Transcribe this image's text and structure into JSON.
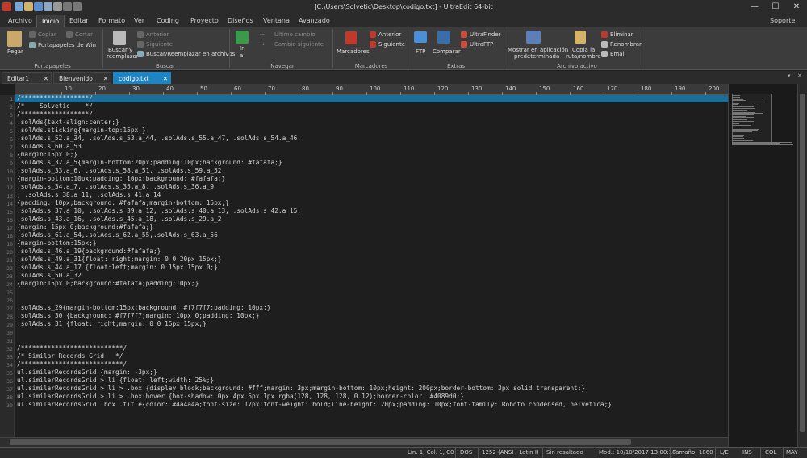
{
  "window": {
    "title": "[C:\\Users\\Solvetic\\Desktop\\codigo.txt] - UltraEdit 64-bit",
    "minimize": "—",
    "maximize": "☐",
    "close": "✕"
  },
  "ribbon_tabs": [
    "Archivo",
    "Inicio",
    "Editar",
    "Formato",
    "Ver",
    "Coding",
    "Proyecto",
    "Diseños",
    "Ventana",
    "Avanzado"
  ],
  "active_ribbon_tab": "Inicio",
  "soporte": "Soporte",
  "ribbon": {
    "pegar": "Pegar",
    "copiar": "Copiar",
    "cortar": "Cortar",
    "portapapeles_win": "Portapapeles de Win",
    "group_portapapeles": "Portapapeles",
    "buscar_y": "Buscar y",
    "reemplazar": "reemplazar",
    "anterior_dim": "Anterior",
    "siguiente_dim": "Siguiente",
    "buscar_reemplazar_archivos": "Buscar/Reemplazar en archivos",
    "group_buscar": "Buscar",
    "ir": "Ir",
    "ir_a": "a",
    "ultimo_cambio": "Último cambio",
    "cambio_siguiente": "Cambio siguiente",
    "group_navegar": "Navegar",
    "marcadores": "Marcadores",
    "anterior": "Anterior",
    "siguiente": "Siguiente",
    "group_marcadores": "Marcadores",
    "ftp": "FTP",
    "comparar": "Comparar",
    "ultrafinder": "UltraFinder",
    "ultraftp": "UltraFTP",
    "group_extras": "Extras",
    "mostrar_app": "Mostrar en aplicación",
    "predeterminada": "predeterminada",
    "copia_la": "Copia la",
    "ruta_nombre": "ruta/nombre",
    "eliminar": "Eliminar",
    "renombrar": "Renombrar",
    "email": "Email",
    "group_archivo_activo": "Archivo activo"
  },
  "doc_tabs": [
    {
      "label": "Editar1"
    },
    {
      "label": "Bienvenido"
    },
    {
      "label": "codigo.txt"
    }
  ],
  "tab_close": "✕",
  "ruler_marks": [
    "10",
    "20",
    "30",
    "40",
    "50",
    "60",
    "70",
    "80",
    "90",
    "100",
    "110",
    "120",
    "130",
    "140",
    "150",
    "160",
    "170",
    "180",
    "190",
    "200"
  ],
  "code_lines": [
    "/******************/",
    "/*    Solvetic    */",
    "/******************/",
    ".solAds{text-align:center;}",
    ".solAds.sticking{margin-top:15px;}",
    ".solAds.s_52.a_34, .solAds.s_53.a_44, .solAds.s_55.a_47, .solAds.s_54.a_46,",
    ".solAds.s_60.a_53",
    "{margin:15px 0;}",
    ".solAds.s_32.a_5{margin-bottom:20px;padding:10px;background: #fafafa;}",
    ".solAds.s_33.a_6, .solAds.s_58.a_51, .solAds.s_59.a_52",
    "{margin-bottom:10px;padding: 10px;background: #fafafa;}",
    ".solAds.s_34.a_7, .solAds.s_35.a_8, .solAds.s_36.a_9",
    ", .solAds.s_38.a_11, .solAds.s_41.a_14",
    "{padding: 10px;background: #fafafa;margin-bottom: 15px;}",
    ".solAds.s_37.a_10, .solAds.s_39.a_12, .solAds.s_40.a_13, .solAds.s_42.a_15,",
    ".solAds.s_43.a_16, .solAds.s_45.a_18, .solAds.s_29.a_2",
    "{margin: 15px 0;background:#fafafa;}",
    ".solAds.s_61.a_54,.solAds.s_62.a_55,.solAds.s_63.a_56",
    "{margin-bottom:15px;}",
    ".solAds.s_46.a_19{background:#fafafa;}",
    ".solAds.s_49.a_31{float: right;margin: 0 0 20px 15px;}",
    ".solAds.s_44.a_17 {float:left;margin: 0 15px 15px 0;}",
    ".solAds.s_50.a_32",
    "{margin:15px 0;background:#fafafa;padding:10px;}",
    "",
    "",
    ".solAds.s_29{margin-bottom:15px;background: #f7f7f7;padding: 10px;}",
    ".solAds.s_30 {background: #f7f7f7;margin: 10px 0;padding: 10px;}",
    ".solAds.s_31 {float: right;margin: 0 0 15px 15px;}",
    "",
    "",
    "/***************************/",
    "/* Similar Records Grid   */",
    "/***************************/",
    "ul.similarRecordsGrid {margin: -3px;}",
    "ul.similarRecordsGrid > li {float: left;width: 25%;}",
    "ul.similarRecordsGrid > li > .box {display:block;background: #fff;margin: 3px;margin-bottom: 10px;height: 200px;border-bottom: 3px solid transparent;}",
    "ul.similarRecordsGrid > li > .box:hover {box-shadow: 0px 4px 5px 1px rgba(128, 128, 128, 0.12);border-color: #4089d0;}",
    "ul.similarRecordsGrid .box .title{color: #4a4a4a;font-size: 17px;font-weight: bold;line-height: 20px;padding: 10px;font-family: Roboto condensed, helvetica;}"
  ],
  "line_numbers": [
    "1",
    "2",
    "3",
    "4",
    "5",
    "6",
    "7",
    "8",
    "9",
    "10",
    "11",
    "12",
    "13",
    "14",
    "15",
    "16",
    "17",
    "18",
    "19",
    "20",
    "21",
    "22",
    "23",
    "24",
    "25",
    "26",
    "27",
    "28",
    "29",
    "30",
    "31",
    "32",
    "33",
    "34",
    "35",
    "36",
    "37",
    "38",
    "39"
  ],
  "status": {
    "position": "Lín. 1, Col. 1, C0",
    "eol": "DOS",
    "encoding": "1252  (ANSI - Latin I)",
    "highlight": "Sin resaltado",
    "modified": "Mod.: 10/10/2017 13:00:18",
    "size": "Tamaño: 1860",
    "rw": "L/E",
    "ins": "INS",
    "col": "COL",
    "may": "MAY"
  },
  "colors": {
    "accent": "#1f84c4",
    "editor_bg": "#1e1e1e",
    "ribbon_bg": "#3c3c3c"
  }
}
